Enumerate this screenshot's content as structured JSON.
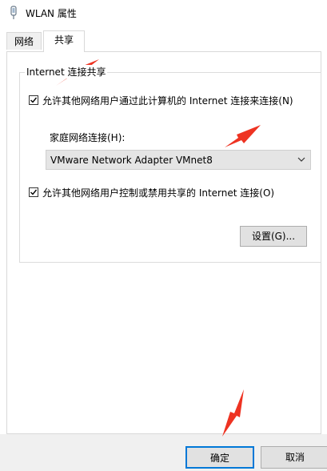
{
  "window": {
    "title": "WLAN 属性",
    "icon": "network-adapter-icon"
  },
  "tabs": [
    {
      "label": "网络",
      "selected": false
    },
    {
      "label": "共享",
      "selected": true
    }
  ],
  "ics": {
    "group_title": "Internet 连接共享",
    "allow_connect": {
      "label": "允许其他网络用户通过此计算机的 Internet 连接来连接(N)",
      "checked": true
    },
    "home_network_label": "家庭网络连接(H):",
    "home_network_value": "VMware Network Adapter VMnet8",
    "allow_control": {
      "label": "允许其他网络用户控制或禁用共享的 Internet 连接(O)",
      "checked": true
    },
    "settings_button": "设置(G)..."
  },
  "footer": {
    "ok_button": "确定",
    "cancel_button": "取消"
  },
  "annotations": {
    "arrow_color": "#ee3322"
  }
}
